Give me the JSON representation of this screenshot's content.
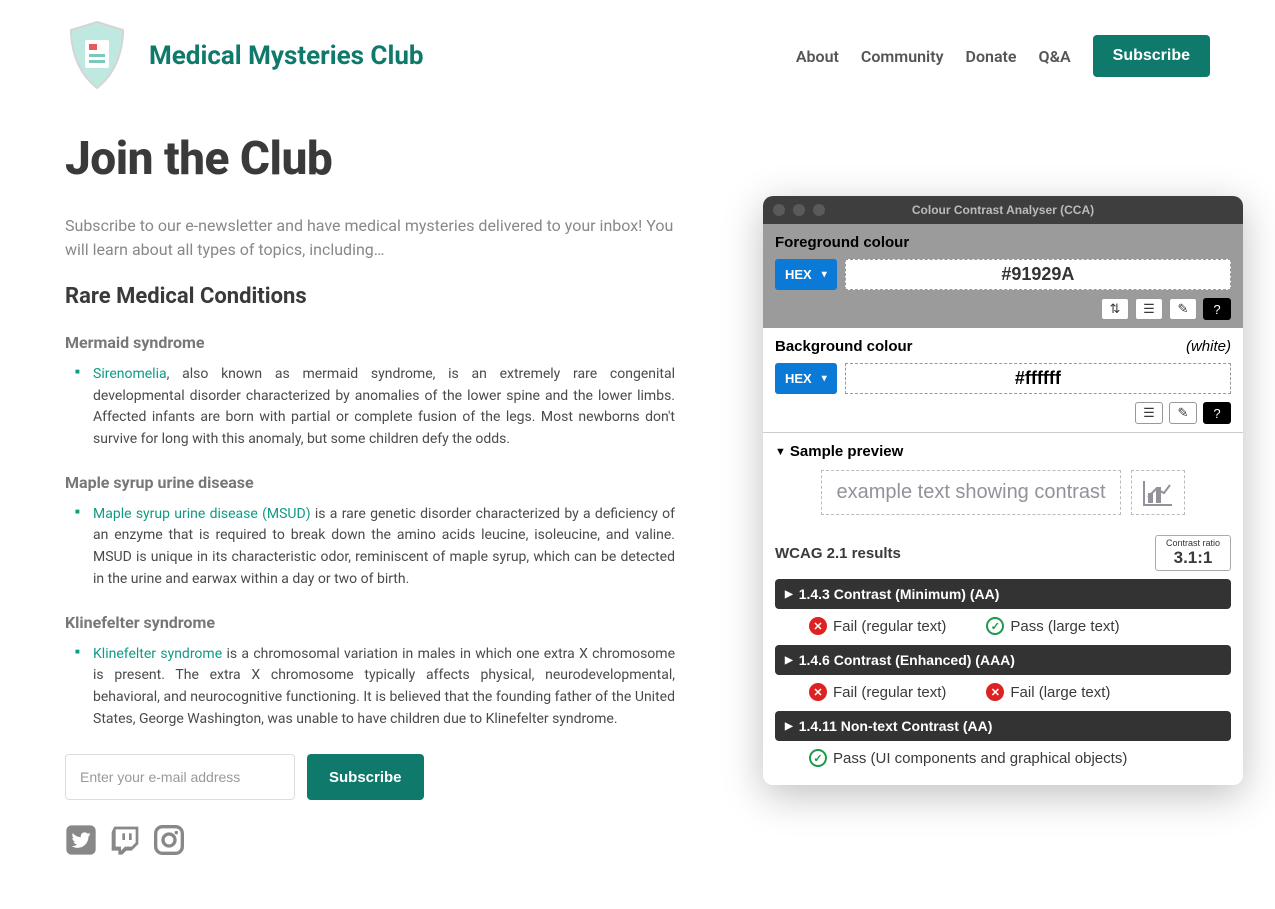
{
  "brand": {
    "title": "Medical Mysteries Club"
  },
  "nav": {
    "about": "About",
    "community": "Community",
    "donate": "Donate",
    "qa": "Q&A",
    "subscribe": "Subscribe"
  },
  "page": {
    "title": "Join the Club",
    "intro": "Subscribe to our e-newsletter and have medical mysteries delivered to your inbox! You will learn about all types of topics, including…",
    "section_heading": "Rare Medical Conditions"
  },
  "conditions": {
    "mermaid": {
      "heading": "Mermaid syndrome",
      "link": "Sirenomelia",
      "text": ", also known as mermaid syndrome, is an extremely rare congenital developmental disorder characterized by anomalies of the lower spine and the lower limbs. Affected infants are born with partial or complete fusion of the legs. Most newborns don't survive for long with this anomaly, but some children defy the odds."
    },
    "maple": {
      "heading": "Maple syrup urine disease",
      "link": "Maple syrup urine disease (MSUD)",
      "text": " is a rare genetic disorder characterized by a deficiency of an enzyme that is required to break down the amino acids leucine, isoleucine, and valine. MSUD is unique in its characteristic odor, reminiscent of maple syrup, which can be detected in the urine and earwax within a day or two of birth."
    },
    "klinefelter": {
      "heading": "Klinefelter syndrome",
      "link": "Klinefelter syndrome",
      "text": " is a chromosomal variation in males in which one extra X chromosome is present. The extra X chromosome typically affects physical, neurodevelopmental, behavioral, and neurocognitive functioning. It is believed that the founding father of the United States, George Washington, was unable to have children due to Klinefelter syndrome."
    }
  },
  "subscribe": {
    "placeholder": "Enter your e-mail address",
    "button": "Subscribe"
  },
  "cca": {
    "title": "Colour Contrast Analyser (CCA)",
    "fg_label": "Foreground colour",
    "bg_label": "Background colour",
    "bg_note": "(white)",
    "hex_label": "HEX",
    "fg_value": "#91929A",
    "bg_value": "#ffffff",
    "sample_label": "Sample preview",
    "sample_text": "example text showing contrast",
    "wcag_heading": "WCAG 2.1 results",
    "ratio_label": "Contrast ratio",
    "ratio_value": "3.1:1",
    "crit1": "1.4.3 Contrast (Minimum) (AA)",
    "crit1_fail": "Fail (regular text)",
    "crit1_pass": "Pass (large text)",
    "crit2": "1.4.6 Contrast (Enhanced) (AAA)",
    "crit2_fail1": "Fail (regular text)",
    "crit2_fail2": "Fail (large text)",
    "crit3": "1.4.11 Non-text Contrast (AA)",
    "crit3_pass": "Pass (UI components and graphical objects)"
  }
}
